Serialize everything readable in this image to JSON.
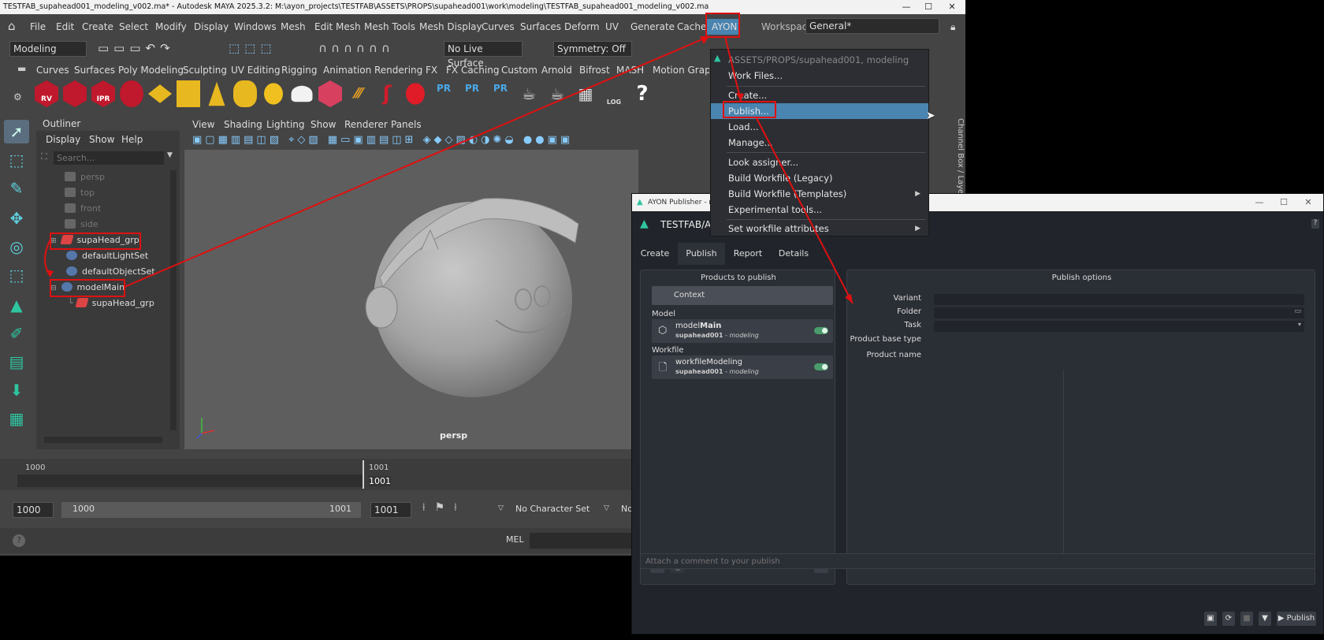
{
  "maya": {
    "title": "TESTFAB_supahead001_modeling_v002.ma* - Autodesk MAYA 2025.3.2: M:\\ayon_projects\\TESTFAB\\ASSETS\\PROPS\\supahead001\\work\\modeling\\TESTFAB_supahead001_modeling_v002.ma",
    "menus": [
      "File",
      "Edit",
      "Create",
      "Select",
      "Modify",
      "Display",
      "Windows",
      "Mesh",
      "Edit Mesh",
      "Mesh Tools",
      "Mesh Display",
      "Curves",
      "Surfaces",
      "Deform",
      "UV",
      "Generate",
      "Cache",
      "AYON"
    ],
    "workspace_label": "Workspace:",
    "workspace_value": "General*",
    "mode": "Modeling",
    "live_surface": "No Live Surface",
    "symmetry": "Symmetry: Off",
    "shelf_tabs": [
      "Curves",
      "Surfaces",
      "Poly Modeling",
      "Sculpting",
      "UV Editing",
      "Rigging",
      "Animation",
      "Rendering",
      "FX",
      "FX Caching",
      "Custom",
      "Arnold",
      "Bifrost",
      "MASH",
      "Motion Graphic"
    ],
    "shelf_labels": {
      "rv": "RV",
      "ipr": "IPR",
      "pr1": "PR",
      "pr2": "PR",
      "pr3": "PR",
      "log": "LOG"
    },
    "channel_box": "Channel Box / Layer"
  },
  "outliner": {
    "title": "Outliner",
    "menus": [
      "Display",
      "Show",
      "Help"
    ],
    "search_placeholder": "Search...",
    "items": [
      {
        "label": "persp",
        "dim": true
      },
      {
        "label": "top",
        "dim": true
      },
      {
        "label": "front",
        "dim": true
      },
      {
        "label": "side",
        "dim": true
      },
      {
        "label": "supaHead_grp",
        "dim": false
      },
      {
        "label": "defaultLightSet",
        "dim": false
      },
      {
        "label": "defaultObjectSet",
        "dim": false
      },
      {
        "label": "modelMain",
        "dim": false
      },
      {
        "label": "supaHead_grp",
        "dim": false
      }
    ]
  },
  "viewport": {
    "menus": [
      "View",
      "Shading",
      "Lighting",
      "Show",
      "Renderer",
      "Panels"
    ],
    "camera_label": "persp"
  },
  "timeline": {
    "start_tick": "1000",
    "current_tick": "1001",
    "current_frame": "1001",
    "range_start": "1000",
    "range_inner_start": "1000",
    "range_inner_end": "1001",
    "range_end": "1001",
    "character_set": "No Character Set",
    "cut_label": "No",
    "mel_label": "MEL"
  },
  "ayon_menu": {
    "context": "ASSETS/PROPS/supahead001, modeling",
    "items": [
      {
        "label": "Work Files..."
      },
      {
        "label": "Create..."
      },
      {
        "label": "Publish..."
      },
      {
        "label": "Load..."
      },
      {
        "label": "Manage..."
      },
      {
        "label": "Look assigner..."
      },
      {
        "label": "Build Workfile (Legacy)"
      },
      {
        "label": "Build Workfile (Templates)"
      },
      {
        "label": "Experimental tools..."
      },
      {
        "label": "Set workfile attributes"
      }
    ]
  },
  "publisher": {
    "window_title": "AYON Publisher - ma",
    "project": "TESTFAB/AS",
    "help": "?",
    "tabs": [
      "Create",
      "Publish",
      "Report",
      "Details"
    ],
    "products_title": "Products to publish",
    "context_label": "Context",
    "model_group": "Model",
    "workfile_group": "Workfile",
    "products": [
      {
        "name_prefix": "model",
        "name_bold": "Main",
        "folder": "supahead001",
        "task": "modeling",
        "enabled": true
      },
      {
        "name_prefix": "workfileModeling",
        "name_bold": "",
        "folder": "supahead001",
        "task": "modeling",
        "enabled": true
      }
    ],
    "options_title": "Publish options",
    "fields": [
      "Variant",
      "Folder",
      "Task",
      "Product base type",
      "Product name"
    ],
    "comment_placeholder": "Attach a comment to your publish",
    "publish_button": "Publish"
  },
  "colors": {
    "annotation_red": "#e01010",
    "menu_highlight": "#4a84b0",
    "ayon_accent": "#2ec5a0"
  }
}
